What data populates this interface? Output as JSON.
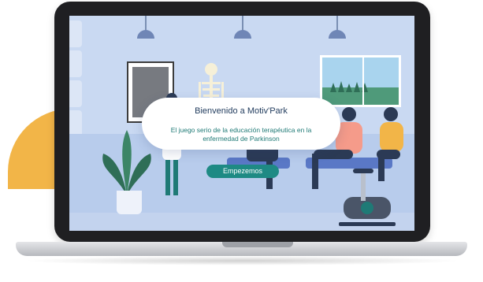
{
  "modal": {
    "title": "Bienvenido a Motiv'Park",
    "subtitle": "El juego serio de la educación terapéutica en la enfermedad de Parkinson",
    "button_label": "Empezemos"
  },
  "colors": {
    "accent": "#1e8a84",
    "title": "#1f3a5c",
    "background_blob": "#f2b548",
    "screen_bg": "#c9d9f2"
  }
}
